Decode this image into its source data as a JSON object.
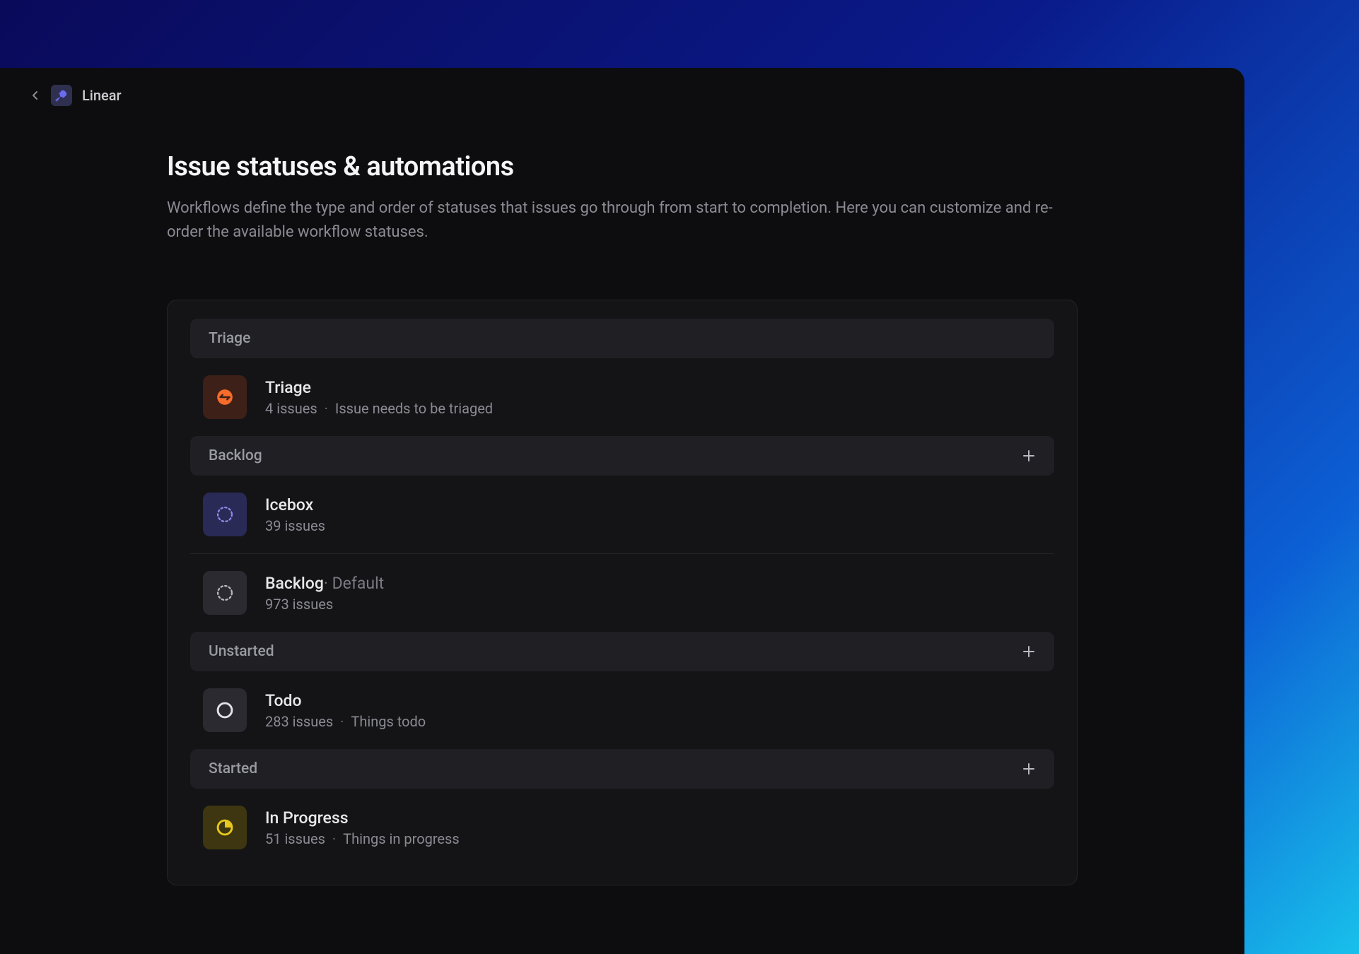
{
  "breadcrumb": {
    "app_name": "Linear"
  },
  "header": {
    "title": "Issue statuses & automations",
    "description": "Workflows define the type and order of statuses that issues go through from start to completion. Here you can customize and re-order the available workflow statuses."
  },
  "sections": {
    "triage": {
      "label": "Triage",
      "addable": false,
      "items": [
        {
          "name": "Triage",
          "count": "4 issues",
          "desc": "Issue needs to be triaged",
          "default": false,
          "icon": "triage"
        }
      ]
    },
    "backlog": {
      "label": "Backlog",
      "addable": true,
      "items": [
        {
          "name": "Icebox",
          "count": "39 issues",
          "desc": "",
          "default": false,
          "icon": "icebox"
        },
        {
          "name": "Backlog",
          "count": "973 issues",
          "desc": "",
          "default": true,
          "default_label": " · Default",
          "icon": "backlog"
        }
      ]
    },
    "unstarted": {
      "label": "Unstarted",
      "addable": true,
      "items": [
        {
          "name": "Todo",
          "count": "283 issues",
          "desc": "Things todo",
          "default": false,
          "icon": "todo"
        }
      ]
    },
    "started": {
      "label": "Started",
      "addable": true,
      "items": [
        {
          "name": "In Progress",
          "count": "51 issues",
          "desc": "Things in progress",
          "default": false,
          "icon": "progress"
        }
      ]
    }
  },
  "colors": {
    "triage_icon": "#f76c2a",
    "icebox_icon": "#6b6bd6",
    "backlog_icon": "#b8b8c0",
    "todo_icon": "#e2e2e8",
    "progress_icon": "#e8c81e"
  }
}
